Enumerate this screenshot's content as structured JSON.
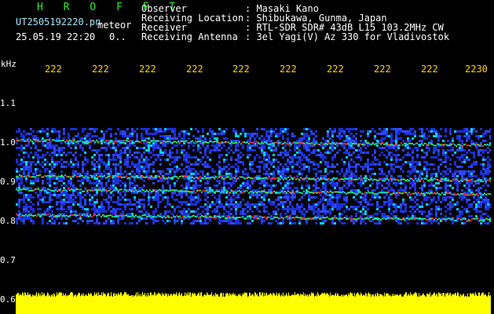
{
  "header": {
    "brand": "H R O F F T",
    "filename": "UT2505192220.pn",
    "meteor_label": "meteor",
    "timestamp": "25.05.19 22:20",
    "meteor_count": "0..",
    "meta": [
      {
        "label": "Observer",
        "value": ": Masaki Kano"
      },
      {
        "label": "Receiving Location",
        "value": ": Shibukawa, Gunma, Japan"
      },
      {
        "label": "Receiver",
        "value": ": RTL-SDR SDR# 43dB L15 103.2MHz CW"
      },
      {
        "label": "Receiving Antenna",
        "value": ": 3el Yagi(V) Az 330 for Vladivostok"
      }
    ]
  },
  "chart_data": {
    "type": "heatmap",
    "ylabel": "kHz",
    "ylim": [
      0.6,
      1.2
    ],
    "x_tick_labels": [
      "222",
      "222",
      "222",
      "222",
      "222",
      "222",
      "222",
      "222",
      "222",
      "2230"
    ],
    "y_tick_labels": [
      "1.1",
      "1.0",
      "0.9",
      "0.8",
      "0.7",
      "0.6"
    ],
    "echo_band": [
      0.785,
      1.03
    ],
    "strong_lines_khz": [
      1.0,
      0.91,
      0.875,
      0.81
    ],
    "colors": {
      "background": "#000000",
      "noise": "#1b2fd8",
      "mid": "#00d0ff",
      "high": "#2ee85a",
      "peak": "#ff2a2a",
      "bottom_bar": "#ffff00"
    }
  }
}
